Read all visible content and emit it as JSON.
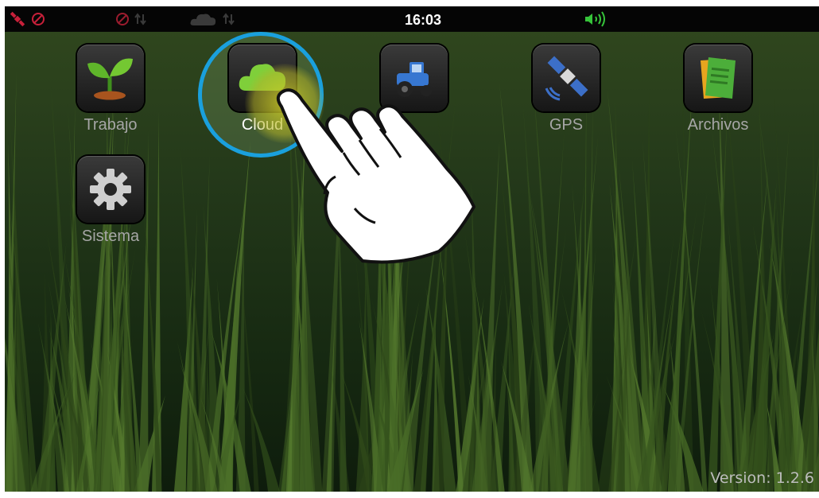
{
  "status_bar": {
    "time": "16:03",
    "icons": [
      "satellite-error-icon",
      "no-connection-icon",
      "sync-error-icon",
      "cloud-icon",
      "volume-icon"
    ]
  },
  "apps": [
    {
      "id": "trabajo",
      "label": "Trabajo",
      "icon": "sprout-icon"
    },
    {
      "id": "cloud",
      "label": "Cloud",
      "icon": "cloud-icon"
    },
    {
      "id": "tractor",
      "label": "",
      "icon": "tractor-icon"
    },
    {
      "id": "gps",
      "label": "GPS",
      "icon": "satellite-icon"
    },
    {
      "id": "archivos",
      "label": "Archivos",
      "icon": "documents-icon"
    },
    {
      "id": "sistema",
      "label": "Sistema",
      "icon": "gear-icon"
    }
  ],
  "overlay": {
    "gesture": "tap",
    "target": "cloud"
  },
  "version_text": "Version: 1.2.6",
  "colors": {
    "highlight_ring": "#1aa0dd",
    "label": "#a6a6a6",
    "status_bar": "#050505"
  }
}
